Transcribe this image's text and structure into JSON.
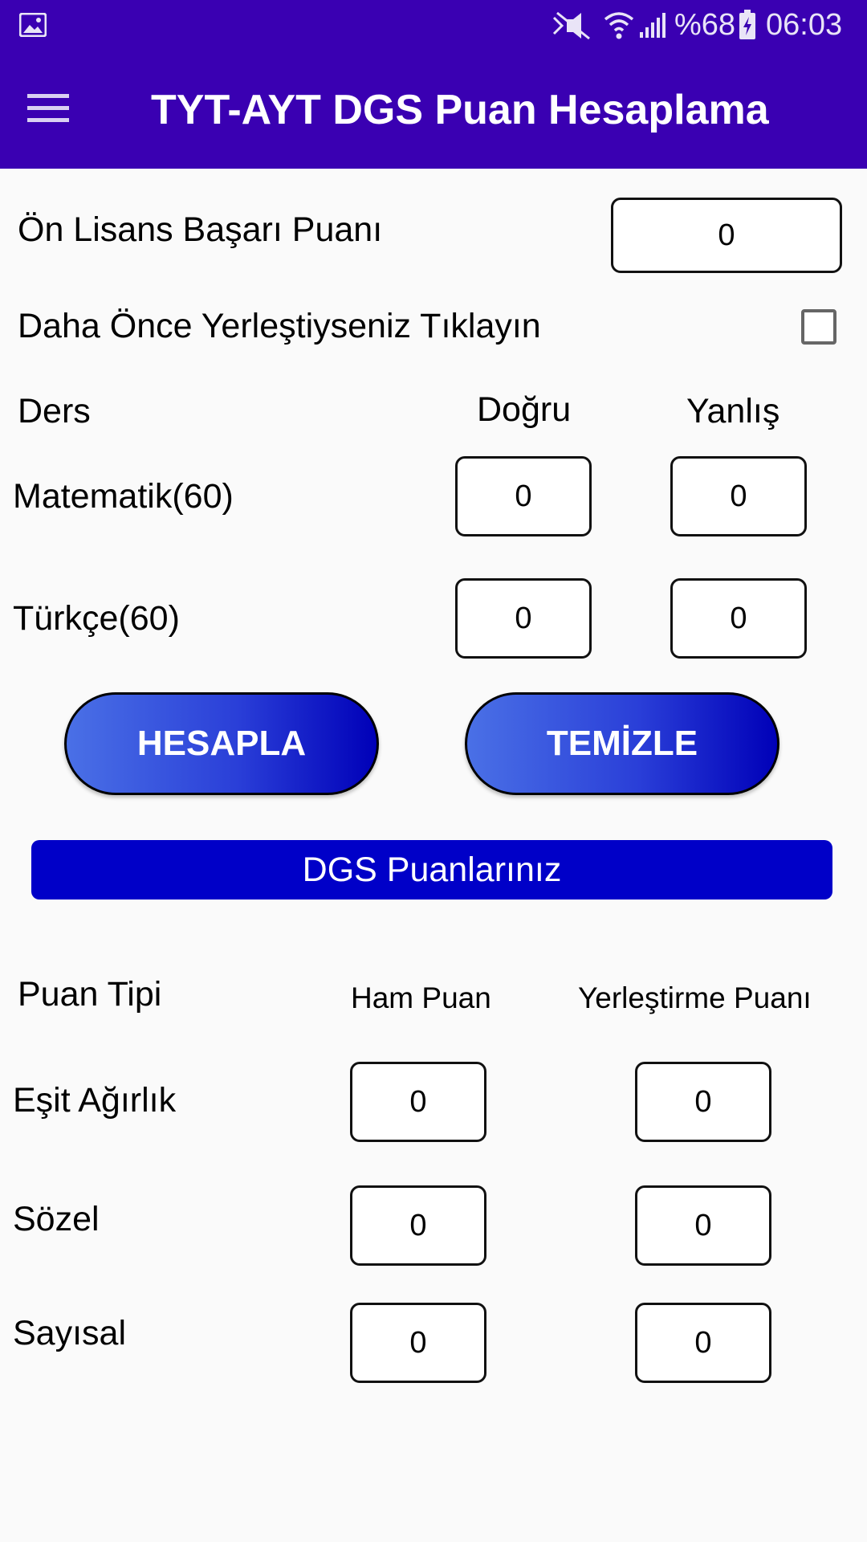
{
  "status_bar": {
    "battery": "%68",
    "time": "06:03",
    "icons": [
      "gallery-icon",
      "mute-icon",
      "wifi-icon",
      "signal-icon",
      "battery-charging-icon"
    ]
  },
  "app_bar": {
    "title": "TYT-AYT DGS Puan Hesaplama",
    "menu_icon": "hamburger-menu-icon"
  },
  "form": {
    "on_lisans_label": "Ön Lisans Başarı Puanı",
    "on_lisans_value": "0",
    "yerlesti_label": "Daha Önce Yerleştiyseniz Tıklayın",
    "yerlesti_checked": false,
    "headers": {
      "ders": "Ders",
      "dogru": "Doğru",
      "yanlis": "Yanlış"
    },
    "subjects": [
      {
        "name": "Matematik(60)",
        "dogru": "0",
        "yanlis": "0"
      },
      {
        "name": "Türkçe(60)",
        "dogru": "0",
        "yanlis": "0"
      }
    ]
  },
  "buttons": {
    "hesapla": "HESAPLA",
    "temizle": "TEMİZLE"
  },
  "results": {
    "banner": "DGS Puanlarınız",
    "headers": {
      "tip": "Puan Tipi",
      "ham": "Ham Puan",
      "yerlestirme": "Yerleştirme Puanı"
    },
    "rows": [
      {
        "tip": "Eşit Ağırlık",
        "ham": "0",
        "yerlestirme": "0"
      },
      {
        "tip": "Sözel",
        "ham": "0",
        "yerlestirme": "0"
      },
      {
        "tip": "Sayısal",
        "ham": "0",
        "yerlestirme": "0"
      }
    ]
  },
  "colors": {
    "primary": "#3a00b2",
    "banner": "#0000c8",
    "button_start": "#4a70e6",
    "button_end": "#0000b8"
  }
}
